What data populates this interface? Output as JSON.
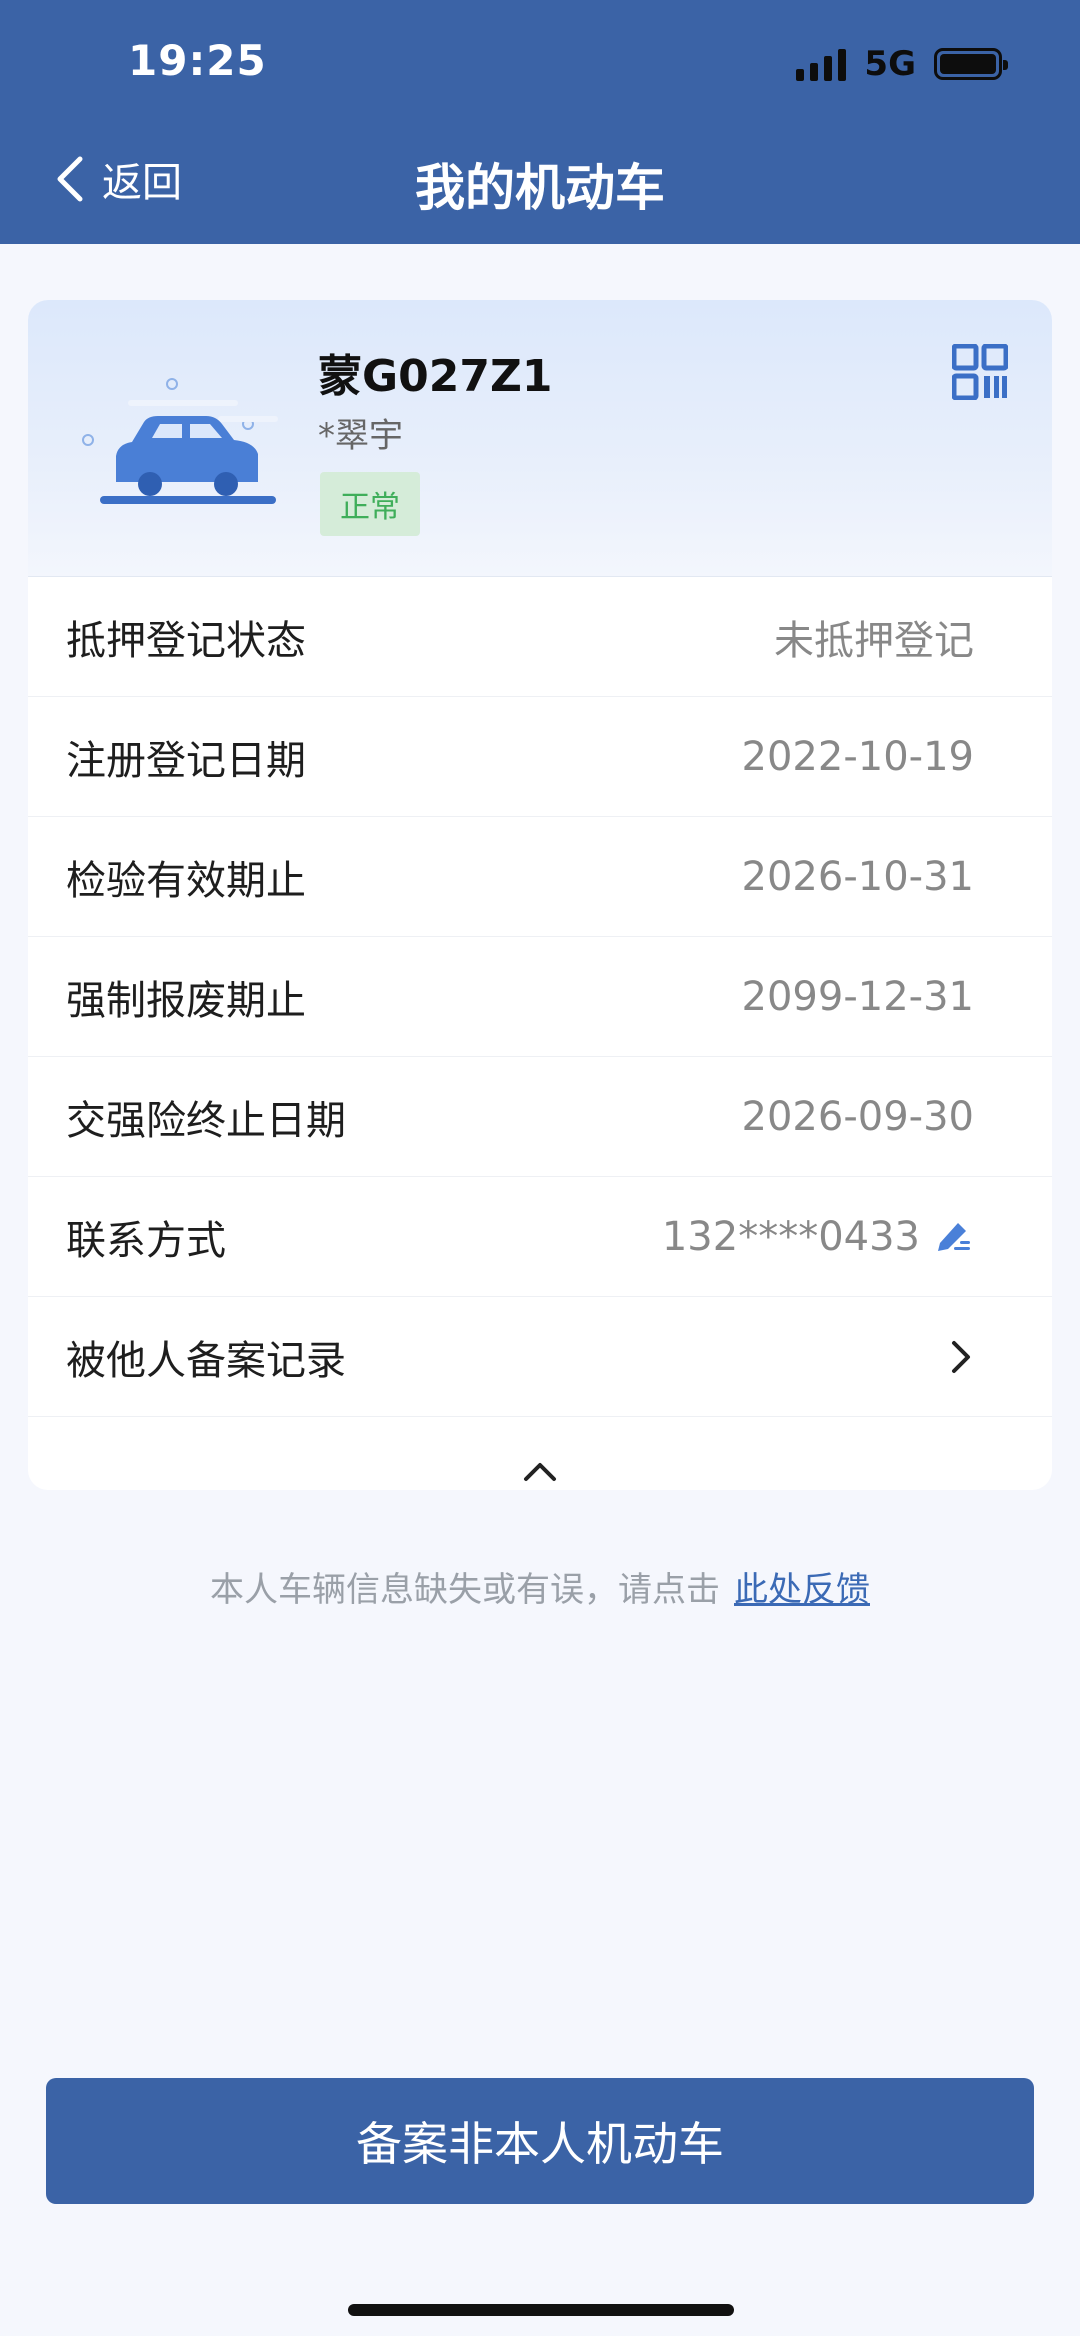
{
  "status_bar": {
    "time": "19:25",
    "network": "5G"
  },
  "header": {
    "back_label": "返回",
    "title": "我的机动车"
  },
  "vehicle": {
    "plate": "蒙G027Z1",
    "owner": "*翠宇",
    "status": "正常",
    "status_color": "#3fae5a",
    "illustration_icon": "car-icon",
    "qr_icon": "qr-code-icon"
  },
  "details": [
    {
      "label": "抵押登记状态",
      "value": "未抵押登记"
    },
    {
      "label": "注册登记日期",
      "value": "2022-10-19"
    },
    {
      "label": "检验有效期止",
      "value": "2026-10-31"
    },
    {
      "label": "强制报废期止",
      "value": "2099-12-31"
    },
    {
      "label": "交强险终止日期",
      "value": "2026-09-30"
    },
    {
      "label": "联系方式",
      "value": "132****0433",
      "icon": "edit-icon"
    },
    {
      "label": "被他人备案记录",
      "icon": "chevron-right-icon"
    }
  ],
  "feedback": {
    "text": "本人车辆信息缺失或有误，请点击",
    "link": "此处反馈"
  },
  "primary_button": {
    "label": "备案非本人机动车"
  },
  "colors": {
    "primary": "#3b63a6",
    "link": "#3b6ab5",
    "background": "#f5f7fd"
  }
}
